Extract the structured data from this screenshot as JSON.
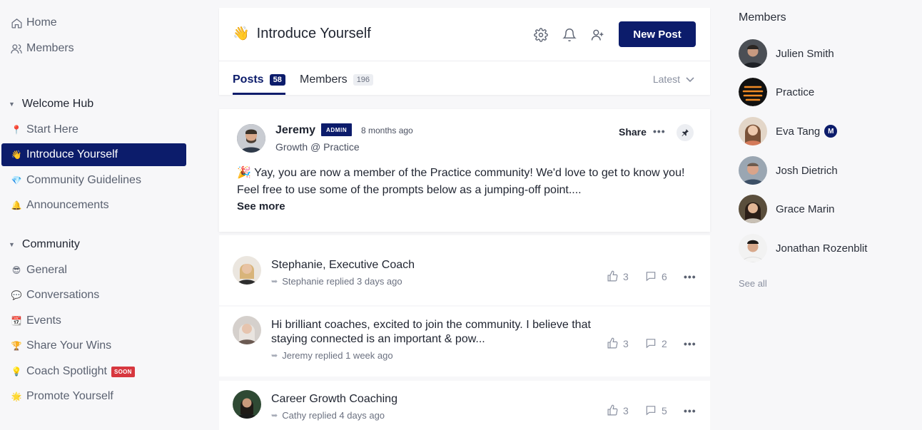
{
  "sidebar": {
    "top": [
      {
        "label": "Home",
        "icon": "home-icon"
      },
      {
        "label": "Members",
        "icon": "members-icon"
      }
    ],
    "sections": [
      {
        "title": "Welcome Hub",
        "items": [
          {
            "label": "Start Here",
            "icon": "pin-emoji",
            "glyph": "📍"
          },
          {
            "label": "Introduce Yourself",
            "icon": "wave-emoji",
            "glyph": "👋",
            "active": true
          },
          {
            "label": "Community Guidelines",
            "icon": "gem-emoji",
            "glyph": "💎"
          },
          {
            "label": "Announcements",
            "icon": "bell-emoji",
            "glyph": "🔔"
          }
        ]
      },
      {
        "title": "Community",
        "items": [
          {
            "label": "General",
            "icon": "sunglasses-emoji",
            "glyph": "😎"
          },
          {
            "label": "Conversations",
            "icon": "speech-bubble-emoji",
            "glyph": "💬"
          },
          {
            "label": "Events",
            "icon": "calendar-emoji",
            "glyph": "📆"
          },
          {
            "label": "Share Your Wins",
            "icon": "trophy-emoji",
            "glyph": "🏆"
          },
          {
            "label": "Coach Spotlight",
            "icon": "lightbulb-emoji",
            "glyph": "💡",
            "badge": "SOON"
          },
          {
            "label": "Promote Yourself",
            "icon": "sparkle-emoji",
            "glyph": "🌟"
          }
        ]
      }
    ]
  },
  "header": {
    "emoji": "👋",
    "title": "Introduce Yourself",
    "new_post_label": "New Post",
    "tabs": [
      {
        "label": "Posts",
        "count": "58",
        "active": true
      },
      {
        "label": "Members",
        "count": "196",
        "active": false
      }
    ],
    "sort_label": "Latest"
  },
  "pinned_post": {
    "author": "Jeremy",
    "badge": "ADMIN",
    "time": "8 months ago",
    "subtitle": "Growth @ Practice",
    "share_label": "Share",
    "body": "🎉 Yay, you are now a member of the Practice community! We'd love to get to know you! Feel free to use some of the prompts below as a jumping-off point....",
    "see_more_label": "See more"
  },
  "threads": [
    {
      "title": "Stephanie, Executive Coach",
      "reply": "Stephanie replied 3 days ago",
      "likes": "3",
      "comments": "6"
    },
    {
      "title": "Hi brilliant coaches, excited to join the community. I believe that staying connected is an important & pow...",
      "reply": "Jeremy replied 1 week ago",
      "likes": "3",
      "comments": "2"
    },
    {
      "title": "Career Growth Coaching",
      "reply": "Cathy replied 4 days ago",
      "likes": "3",
      "comments": "5"
    }
  ],
  "members_panel": {
    "title": "Members",
    "members": [
      {
        "name": "Julien Smith"
      },
      {
        "name": "Practice"
      },
      {
        "name": "Eva Tang",
        "badge": "M"
      },
      {
        "name": "Josh Dietrich"
      },
      {
        "name": "Grace Marin"
      },
      {
        "name": "Jonathan Rozenblit"
      }
    ],
    "see_all_label": "See all"
  }
}
